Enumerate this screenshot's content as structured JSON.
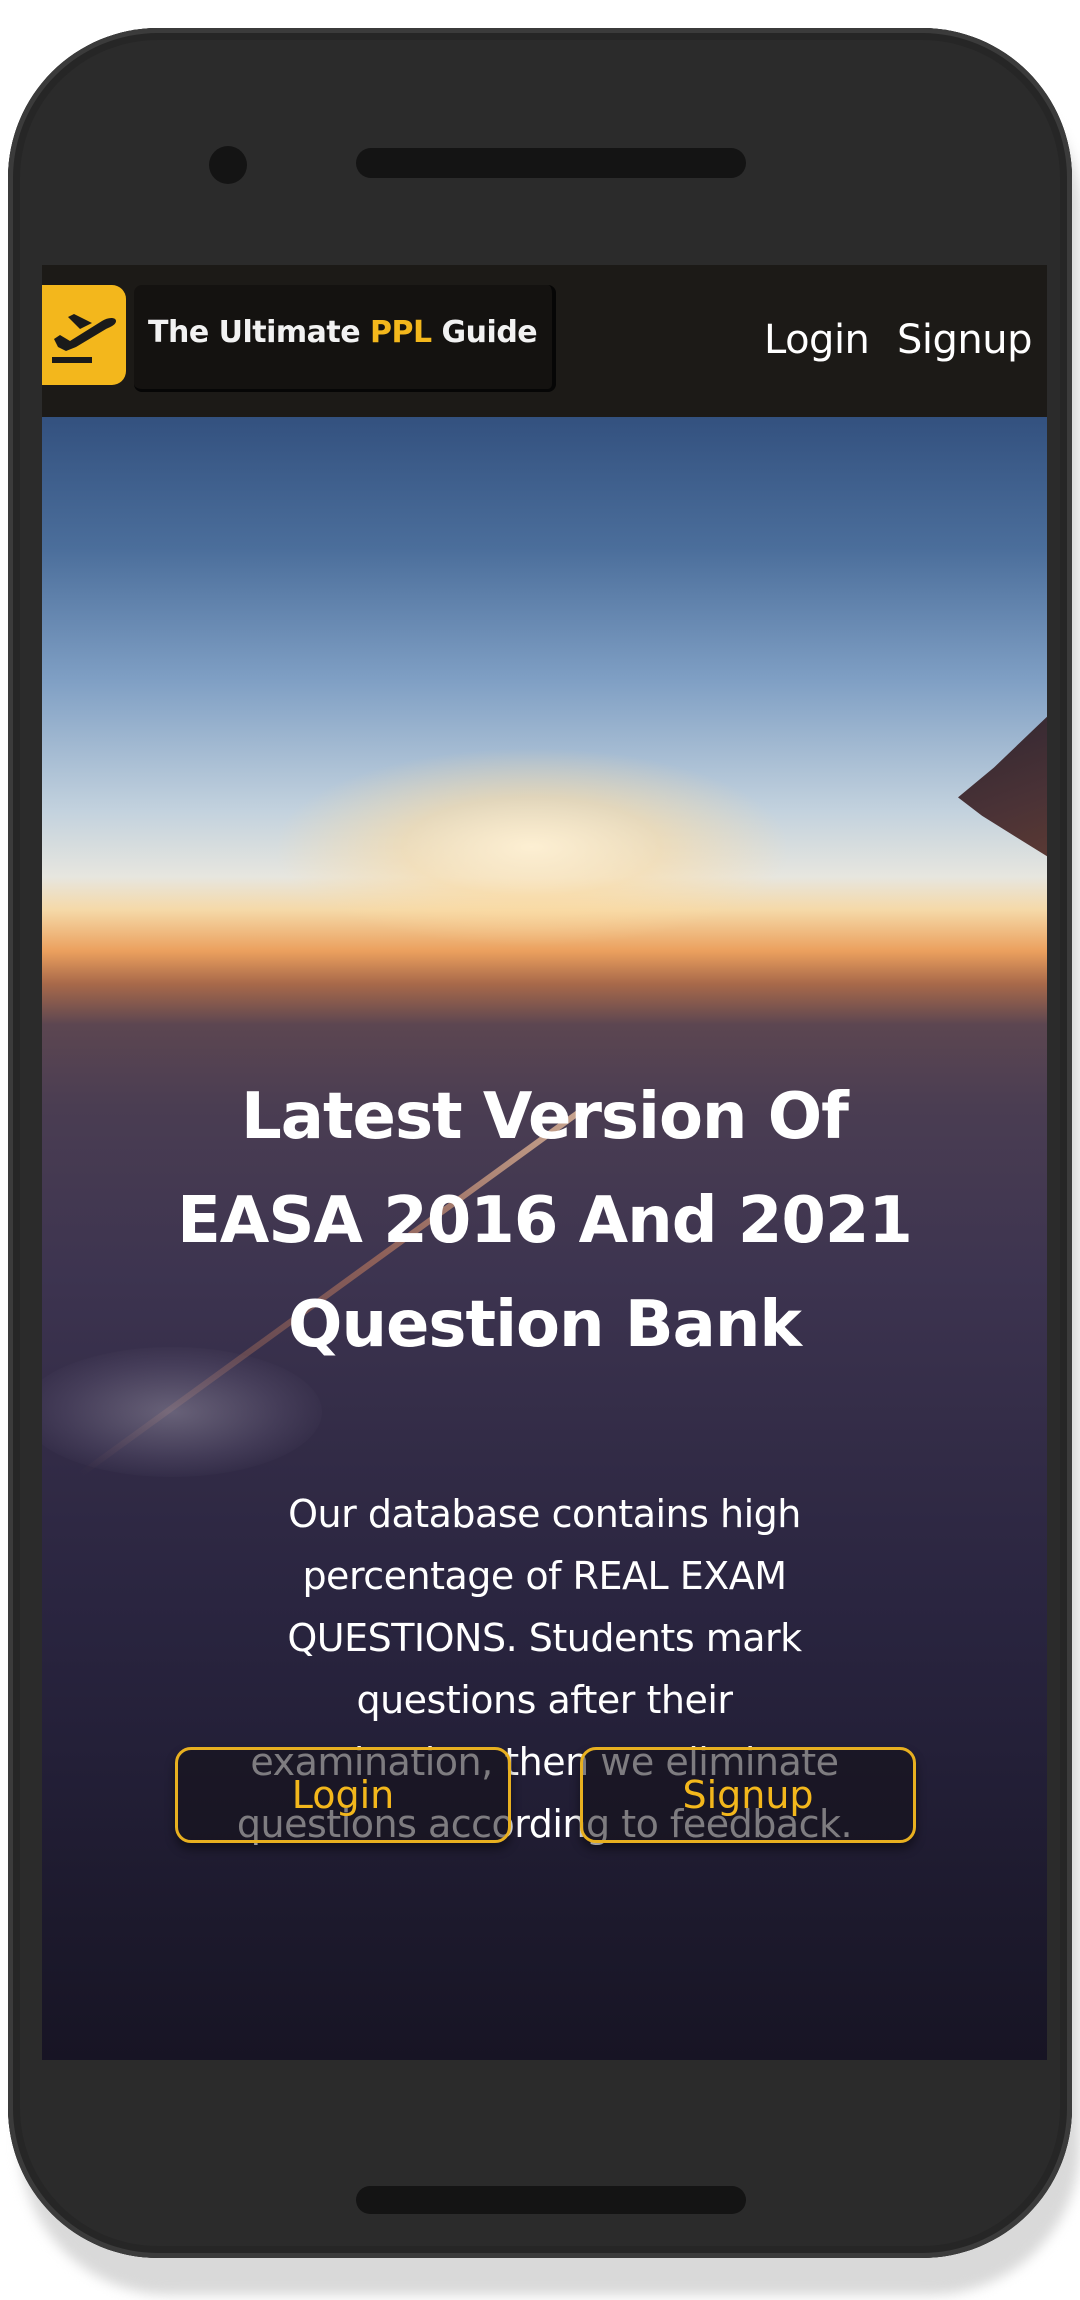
{
  "brand": {
    "logo_icon": "airplane-departure-icon",
    "name_prefix": "The Ultimate ",
    "name_accent": "PPL",
    "name_suffix": " Guide",
    "accent_color": "#f3b71c"
  },
  "nav": {
    "login_label": "Login",
    "signup_label": "Signup"
  },
  "hero": {
    "title": "Latest Version Of EASA 2016 And 2021 Question Bank",
    "description": "Our database contains high percentage of REAL EXAM QUESTIONS. Students mark questions after their examination, then we eliminate questions according to feedback.",
    "login_button": "Login",
    "signup_button": "Signup"
  }
}
